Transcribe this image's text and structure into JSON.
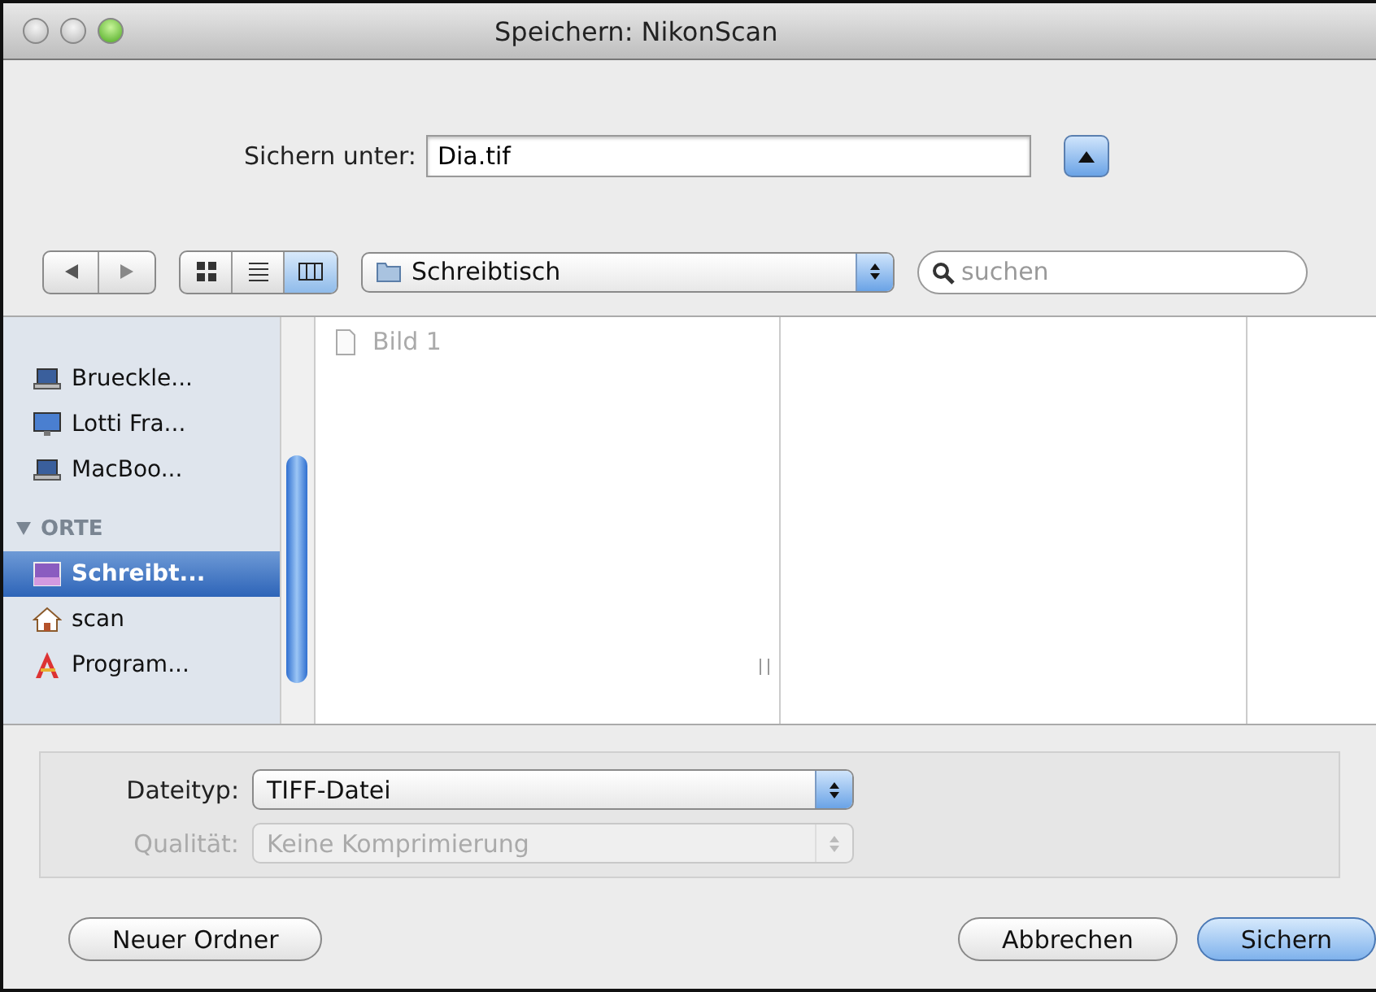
{
  "window": {
    "title": "Speichern: NikonScan"
  },
  "save_as": {
    "label": "Sichern unter:",
    "value": "Dia.tif",
    "expanded": true
  },
  "view_modes": [
    {
      "kind": "icons",
      "selected": false
    },
    {
      "kind": "list",
      "selected": false
    },
    {
      "kind": "columns",
      "selected": true
    }
  ],
  "location": {
    "value": "Schreibtisch"
  },
  "search": {
    "placeholder": "suchen"
  },
  "sidebar": {
    "groups": [
      {
        "items": [
          {
            "label": "Brueckle...",
            "kind": "laptop",
            "selected": false
          },
          {
            "label": "Lotti Fra...",
            "kind": "desktop",
            "selected": false
          },
          {
            "label": "MacBoo...",
            "kind": "laptop",
            "selected": false
          }
        ]
      },
      {
        "title": "ORTE",
        "expanded": true,
        "items": [
          {
            "label": "Schreibt...",
            "kind": "desk",
            "selected": true
          },
          {
            "label": "scan",
            "kind": "home",
            "selected": false
          },
          {
            "label": "Program...",
            "kind": "apps",
            "selected": false
          }
        ]
      }
    ]
  },
  "columns": [
    {
      "items": [
        {
          "label": "Bild 1",
          "disabled": true
        }
      ]
    },
    {}
  ],
  "options": [
    {
      "label": "Dateityp:",
      "value": "TIFF-Datei",
      "disabled": false
    },
    {
      "label": "Qualität:",
      "value": "Keine Komprimierung",
      "disabled": true
    }
  ],
  "buttons": [
    {
      "label": "Neuer Ordner",
      "default": false
    },
    {
      "label": "Abbrechen",
      "default": false
    },
    {
      "label": "Sichern",
      "default": true
    }
  ]
}
